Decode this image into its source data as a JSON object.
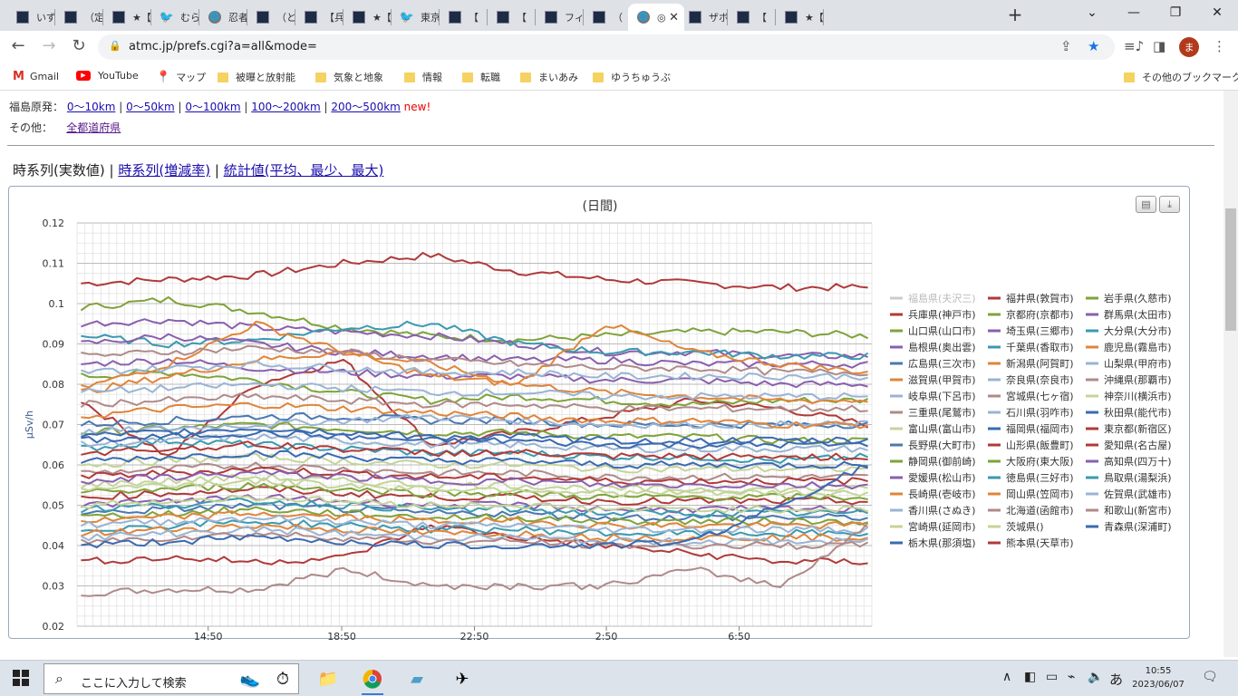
{
  "browser": {
    "tabs": [
      {
        "title": "いずれ",
        "icon": "page-favicon"
      },
      {
        "title": "（定",
        "icon": "page-favicon"
      },
      {
        "title": "★【",
        "icon": "page-favicon"
      },
      {
        "title": "むらこ",
        "icon": "twitter-icon"
      },
      {
        "title": "忍者",
        "icon": "globe-icon"
      },
      {
        "title": "（と",
        "icon": "page-favicon"
      },
      {
        "title": "【兵",
        "icon": "page-favicon"
      },
      {
        "title": "★【",
        "icon": "page-favicon"
      },
      {
        "title": "東京",
        "icon": "twitter-icon"
      },
      {
        "title": "【",
        "icon": "page-favicon"
      },
      {
        "title": "【",
        "icon": "page-favicon"
      },
      {
        "title": "フィラ",
        "icon": "page-favicon"
      },
      {
        "title": "（",
        "icon": "page-favicon"
      },
      {
        "title": "◎",
        "icon": "globe-icon",
        "active": true
      },
      {
        "title": "ザボ",
        "icon": "page-favicon"
      },
      {
        "title": "【",
        "icon": "page-favicon"
      },
      {
        "title": "★【",
        "icon": "page-favicon"
      }
    ],
    "url": "atmc.jp/prefs.cgi?a=all&mode=",
    "avatar_letter": "ま",
    "bookmarks": [
      {
        "label": "Gmail",
        "icon": "gmail-icon"
      },
      {
        "label": "YouTube",
        "icon": "youtube-icon"
      },
      {
        "label": "マップ",
        "icon": "maps-icon"
      },
      {
        "label": "被曝と放射能",
        "icon": "folder-icon"
      },
      {
        "label": "気象と地象",
        "icon": "folder-icon"
      },
      {
        "label": "情報",
        "icon": "folder-icon"
      },
      {
        "label": "転職",
        "icon": "folder-icon"
      },
      {
        "label": "まいあみ",
        "icon": "folder-icon"
      },
      {
        "label": "ゆうちゅうぶ",
        "icon": "folder-icon"
      }
    ],
    "other_bookmarks": "その他のブックマーク"
  },
  "page": {
    "fukushima_label": "福島原発：",
    "fukushima_links": [
      "0〜10km",
      "0〜50km",
      "0〜100km",
      "100〜200km",
      "200〜500km"
    ],
    "new_label": "new!",
    "other_label": "その他：",
    "other_link": "全都道府県",
    "view_current": "時系列(実数値)",
    "view_links": [
      "時系列(増減率)",
      "統計値(平均、最少、最大)"
    ],
    "separator": "|"
  },
  "chart_data": {
    "type": "line",
    "title": "(日間)",
    "ylabel": "μSv/h",
    "ylim": [
      0.02,
      0.12
    ],
    "yticks": [
      "0.02",
      "0.03",
      "0.04",
      "0.05",
      "0.06",
      "0.07",
      "0.08",
      "0.09",
      "0.1",
      "0.11",
      "0.12"
    ],
    "xticks": [
      "14:50",
      "18:50",
      "22:50",
      "2:50",
      "6:50"
    ],
    "points_per_series": 100,
    "series": [
      {
        "name": "福島県(夫沢三)",
        "color": "#c8c8c8",
        "hidden": true,
        "levels": []
      },
      {
        "name": "福井県(敦賀市)",
        "color": "#b03a3a",
        "levels": [
          0.105,
          0.106,
          0.107,
          0.11,
          0.112,
          0.108,
          0.106,
          0.105,
          0.104,
          0.104
        ]
      },
      {
        "name": "岩手県(久慈市)",
        "color": "#7fa33a",
        "levels": [
          0.099,
          0.101,
          0.098,
          0.094,
          0.092,
          0.091,
          0.092,
          0.093,
          0.093,
          0.092
        ]
      },
      {
        "name": "兵庫県(神戸市)",
        "color": "#b03a3a",
        "levels": [
          0.076,
          0.062,
          0.08,
          0.086,
          0.065,
          0.068,
          0.072,
          0.076,
          0.074,
          0.07
        ]
      },
      {
        "name": "京都府(京都市)",
        "color": "#7fa33a",
        "levels": [
          0.082,
          0.083,
          0.081,
          0.078,
          0.076,
          0.077,
          0.076,
          0.075,
          0.076,
          0.076
        ]
      },
      {
        "name": "群馬県(太田市)",
        "color": "#8a5fae",
        "levels": [
          0.095,
          0.096,
          0.094,
          0.093,
          0.092,
          0.09,
          0.088,
          0.088,
          0.087,
          0.087
        ]
      },
      {
        "name": "山口県(山口市)",
        "color": "#7fa33a",
        "levels": [
          0.068,
          0.069,
          0.07,
          0.069,
          0.068,
          0.068,
          0.067,
          0.067,
          0.066,
          0.066
        ]
      },
      {
        "name": "埼玉県(三郷市)",
        "color": "#8a5fae",
        "levels": [
          0.085,
          0.086,
          0.084,
          0.083,
          0.082,
          0.082,
          0.081,
          0.081,
          0.08,
          0.08
        ]
      },
      {
        "name": "大分県(大分市)",
        "color": "#3a9ab0",
        "levels": [
          0.092,
          0.09,
          0.091,
          0.094,
          0.095,
          0.09,
          0.088,
          0.088,
          0.087,
          0.087
        ]
      },
      {
        "name": "島根県(奥出雲)",
        "color": "#8a5fae",
        "levels": [
          0.09,
          0.092,
          0.09,
          0.088,
          0.087,
          0.086,
          0.086,
          0.085,
          0.085,
          0.085
        ]
      },
      {
        "name": "千葉県(香取市)",
        "color": "#3a9ab0",
        "levels": [
          0.064,
          0.066,
          0.065,
          0.064,
          0.063,
          0.063,
          0.062,
          0.062,
          0.061,
          0.062
        ]
      },
      {
        "name": "鹿児島(霧島市)",
        "color": "#e0853a",
        "levels": [
          0.079,
          0.085,
          0.095,
          0.088,
          0.082,
          0.08,
          0.095,
          0.088,
          0.085,
          0.083
        ]
      },
      {
        "name": "広島県(三次市)",
        "color": "#4a78b0",
        "levels": [
          0.07,
          0.071,
          0.072,
          0.072,
          0.071,
          0.071,
          0.07,
          0.07,
          0.07,
          0.07
        ]
      },
      {
        "name": "新潟県(阿賀町)",
        "color": "#e0853a",
        "levels": [
          0.078,
          0.082,
          0.086,
          0.088,
          0.085,
          0.08,
          0.078,
          0.077,
          0.076,
          0.076
        ]
      },
      {
        "name": "山梨県(甲府市)",
        "color": "#99b4d4",
        "levels": [
          0.068,
          0.069,
          0.07,
          0.071,
          0.072,
          0.071,
          0.07,
          0.07,
          0.07,
          0.07
        ]
      },
      {
        "name": "滋賀県(甲賀市)",
        "color": "#e0853a",
        "levels": [
          0.072,
          0.074,
          0.075,
          0.074,
          0.073,
          0.072,
          0.071,
          0.071,
          0.07,
          0.07
        ]
      },
      {
        "name": "奈良県(奈良市)",
        "color": "#99b4d4",
        "levels": [
          0.065,
          0.066,
          0.067,
          0.066,
          0.065,
          0.065,
          0.064,
          0.064,
          0.064,
          0.064
        ]
      },
      {
        "name": "沖縄県(那覇市)",
        "color": "#b08a8a",
        "levels": [
          0.058,
          0.059,
          0.06,
          0.059,
          0.058,
          0.058,
          0.057,
          0.057,
          0.057,
          0.057
        ]
      },
      {
        "name": "岐阜県(下呂市)",
        "color": "#99b4d4",
        "levels": [
          0.083,
          0.084,
          0.085,
          0.084,
          0.083,
          0.083,
          0.082,
          0.082,
          0.082,
          0.082
        ]
      },
      {
        "name": "宮城県(七ヶ宿)",
        "color": "#b08a8a",
        "levels": [
          0.087,
          0.088,
          0.089,
          0.088,
          0.086,
          0.085,
          0.084,
          0.084,
          0.083,
          0.083
        ]
      },
      {
        "name": "神奈川(横浜市)",
        "color": "#c4d49a",
        "levels": [
          0.06,
          0.061,
          0.062,
          0.061,
          0.06,
          0.06,
          0.059,
          0.059,
          0.059,
          0.059
        ]
      },
      {
        "name": "三重県(尾鷲市)",
        "color": "#b08a8a",
        "levels": [
          0.075,
          0.076,
          0.077,
          0.076,
          0.075,
          0.075,
          0.074,
          0.074,
          0.074,
          0.074
        ]
      },
      {
        "name": "石川県(羽咋市)",
        "color": "#99b4d4",
        "levels": [
          0.078,
          0.079,
          0.08,
          0.079,
          0.078,
          0.078,
          0.077,
          0.077,
          0.077,
          0.077
        ]
      },
      {
        "name": "秋田県(能代市)",
        "color": "#3a6ab0",
        "levels": [
          0.066,
          0.067,
          0.068,
          0.067,
          0.066,
          0.066,
          0.065,
          0.065,
          0.065,
          0.065
        ]
      },
      {
        "name": "富山県(富山市)",
        "color": "#c4d49a",
        "levels": [
          0.055,
          0.056,
          0.057,
          0.056,
          0.055,
          0.055,
          0.054,
          0.054,
          0.054,
          0.054
        ]
      },
      {
        "name": "福岡県(福岡市)",
        "color": "#3a6ab0",
        "levels": [
          0.061,
          0.062,
          0.063,
          0.062,
          0.061,
          0.061,
          0.06,
          0.06,
          0.06,
          0.06
        ]
      },
      {
        "name": "東京都(新宿区)",
        "color": "#b03a3a",
        "levels": [
          0.036,
          0.037,
          0.036,
          0.037,
          0.045,
          0.042,
          0.04,
          0.038,
          0.036,
          0.036
        ]
      },
      {
        "name": "長野県(大町市)",
        "color": "#4a78b0",
        "levels": [
          0.048,
          0.049,
          0.05,
          0.049,
          0.048,
          0.048,
          0.047,
          0.047,
          0.047,
          0.047
        ]
      },
      {
        "name": "山形県(飯豊町)",
        "color": "#b03a3a",
        "levels": [
          0.057,
          0.058,
          0.059,
          0.058,
          0.057,
          0.057,
          0.056,
          0.056,
          0.056,
          0.056
        ]
      },
      {
        "name": "愛知県(名古屋)",
        "color": "#b03a3a",
        "levels": [
          0.052,
          0.053,
          0.054,
          0.053,
          0.052,
          0.052,
          0.051,
          0.051,
          0.051,
          0.051
        ]
      },
      {
        "name": "静岡県(御前崎)",
        "color": "#7fa33a",
        "levels": [
          0.053,
          0.054,
          0.055,
          0.054,
          0.053,
          0.053,
          0.052,
          0.052,
          0.052,
          0.052
        ]
      },
      {
        "name": "大阪府(東大阪)",
        "color": "#7fa33a",
        "levels": [
          0.047,
          0.048,
          0.049,
          0.048,
          0.047,
          0.047,
          0.046,
          0.046,
          0.046,
          0.046
        ]
      },
      {
        "name": "高知県(四万十)",
        "color": "#8a5fae",
        "levels": [
          0.05,
          0.051,
          0.052,
          0.051,
          0.05,
          0.05,
          0.049,
          0.049,
          0.049,
          0.049
        ]
      },
      {
        "name": "愛媛県(松山市)",
        "color": "#8a5fae",
        "levels": [
          0.056,
          0.057,
          0.058,
          0.057,
          0.056,
          0.056,
          0.055,
          0.055,
          0.055,
          0.055
        ]
      },
      {
        "name": "徳島県(三好市)",
        "color": "#3a9ab0",
        "levels": [
          0.049,
          0.05,
          0.051,
          0.05,
          0.049,
          0.049,
          0.048,
          0.048,
          0.048,
          0.048
        ]
      },
      {
        "name": "鳥取県(湯梨浜)",
        "color": "#3a9ab0",
        "levels": [
          0.044,
          0.045,
          0.046,
          0.045,
          0.044,
          0.044,
          0.043,
          0.043,
          0.043,
          0.043
        ]
      },
      {
        "name": "長崎県(壱岐市)",
        "color": "#e0853a",
        "levels": [
          0.046,
          0.047,
          0.048,
          0.047,
          0.046,
          0.046,
          0.045,
          0.045,
          0.045,
          0.045
        ]
      },
      {
        "name": "岡山県(笠岡市)",
        "color": "#e0853a",
        "levels": [
          0.043,
          0.044,
          0.045,
          0.044,
          0.043,
          0.043,
          0.042,
          0.042,
          0.042,
          0.042
        ]
      },
      {
        "name": "佐賀県(武雄市)",
        "color": "#99b4d4",
        "levels": [
          0.045,
          0.046,
          0.047,
          0.046,
          0.045,
          0.045,
          0.044,
          0.044,
          0.044,
          0.044
        ]
      },
      {
        "name": "香川県(さぬき)",
        "color": "#99b4d4",
        "levels": [
          0.042,
          0.043,
          0.044,
          0.043,
          0.042,
          0.042,
          0.041,
          0.041,
          0.041,
          0.041
        ]
      },
      {
        "name": "北海道(函館市)",
        "color": "#b08a8a",
        "levels": [
          0.041,
          0.042,
          0.043,
          0.042,
          0.041,
          0.041,
          0.04,
          0.04,
          0.04,
          0.04
        ]
      },
      {
        "name": "和歌山(新宮市)",
        "color": "#b08a8a",
        "levels": [
          0.028,
          0.029,
          0.029,
          0.034,
          0.03,
          0.03,
          0.03,
          0.034,
          0.03,
          0.045
        ]
      },
      {
        "name": "宮崎県(延岡市)",
        "color": "#c4d49a",
        "levels": [
          0.05,
          0.051,
          0.052,
          0.051,
          0.05,
          0.05,
          0.049,
          0.049,
          0.049,
          0.049
        ]
      },
      {
        "name": "茨城県()",
        "color": "#c4d49a",
        "levels": [
          0.054,
          0.055,
          0.056,
          0.055,
          0.054,
          0.054,
          0.053,
          0.053,
          0.053,
          0.053
        ]
      },
      {
        "name": "青森県(深浦町)",
        "color": "#3a6ab0",
        "levels": [
          0.04,
          0.041,
          0.042,
          0.041,
          0.04,
          0.04,
          0.04,
          0.041,
          0.05,
          0.06
        ]
      },
      {
        "name": "栃木県(那須塩)",
        "color": "#3a6ab0",
        "levels": [
          0.067,
          0.068,
          0.069,
          0.068,
          0.067,
          0.067,
          0.066,
          0.066,
          0.066,
          0.066
        ]
      },
      {
        "name": "熊本県(天草市)",
        "color": "#b03a3a",
        "levels": [
          0.063,
          0.064,
          0.065,
          0.064,
          0.063,
          0.063,
          0.062,
          0.062,
          0.062,
          0.062
        ]
      }
    ]
  },
  "taskbar": {
    "search_placeholder": "ここに入力して検索",
    "ime": "あ",
    "time": "10:55",
    "date": "2023/06/07"
  }
}
